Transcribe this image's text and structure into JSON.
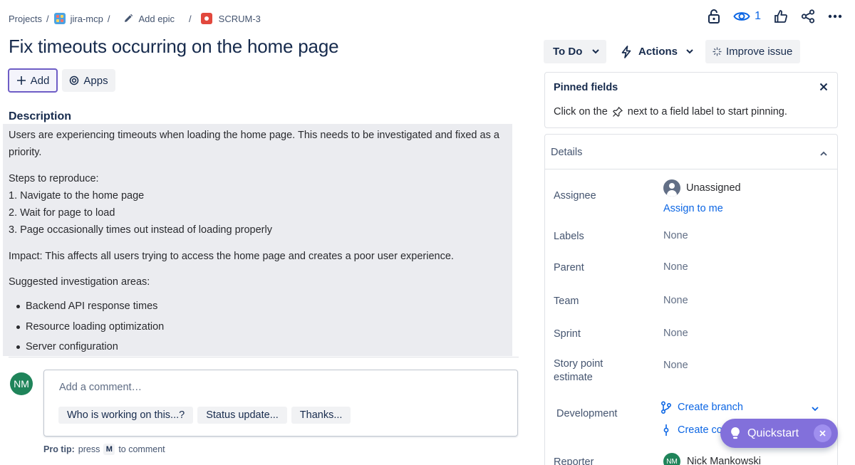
{
  "breadcrumb": {
    "projects": "Projects",
    "project": "jira-mcp",
    "epic": "Add epic",
    "issue_key": "SCRUM-3",
    "separator": "/"
  },
  "header": {
    "watch_count": "1"
  },
  "issue": {
    "title": "Fix timeouts occurring on the home page",
    "add_label": "Add",
    "apps_label": "Apps"
  },
  "description": {
    "heading": "Description",
    "paragraph1": "Users are experiencing timeouts when loading the home page. This needs to be investigated and fixed as a priority.",
    "steps_heading": "Steps to reproduce:",
    "steps": [
      "1. Navigate to the home page",
      "2. Wait for page to load",
      "3. Page occasionally times out instead of loading properly"
    ],
    "impact": "Impact: This affects all users trying to access the home page and creates a poor user experience.",
    "areas_heading": "Suggested investigation areas:",
    "areas": [
      "Backend API response times",
      "Resource loading optimization",
      "Server configuration"
    ]
  },
  "comment": {
    "avatar_initials": "NM",
    "placeholder": "Add a comment…",
    "suggestions": [
      "Who is working on this...?",
      "Status update...",
      "Thanks..."
    ],
    "protip_label": "Pro tip:",
    "protip_press": "press",
    "protip_key": "M",
    "protip_suffix": "to comment"
  },
  "sidebar": {
    "status_label": "To Do",
    "actions_label": "Actions",
    "improve_label": "Improve issue",
    "pinned": {
      "title": "Pinned fields",
      "text_before": "Click on the",
      "text_after": "next to a field label to start pinning."
    },
    "details": {
      "title": "Details",
      "fields": {
        "assignee_label": "Assignee",
        "assignee_value": "Unassigned",
        "assign_to_me": "Assign to me",
        "labels_label": "Labels",
        "labels_value": "None",
        "parent_label": "Parent",
        "parent_value": "None",
        "team_label": "Team",
        "team_value": "None",
        "sprint_label": "Sprint",
        "sprint_value": "None",
        "story_points_label": "Story point estimate",
        "story_points_value": "None",
        "development_label": "Development",
        "create_branch": "Create branch",
        "create_commit": "Create co",
        "reporter_label": "Reporter",
        "reporter_initials": "NM",
        "reporter_name": "Nick Mankowski"
      }
    }
  },
  "quickstart": {
    "label": "Quickstart"
  },
  "colors": {
    "accent": "#0c66e4",
    "quickstart": "#8270db",
    "avatar": "#1f845a",
    "issue_icon": "#e2483d"
  }
}
